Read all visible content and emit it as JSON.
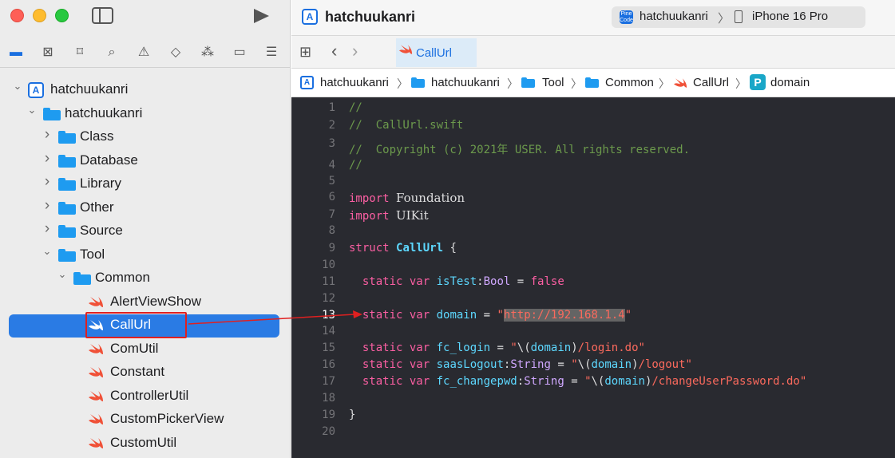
{
  "window": {
    "title": "hatchuukanri"
  },
  "scheme": {
    "name": "hatchuukanri",
    "device": "iPhone 16 Pro",
    "icon_text": "Pine Code"
  },
  "tabs": [
    {
      "label": "CallUrl"
    }
  ],
  "jumpbar": [
    {
      "label": "hatchuukanri",
      "icon": "app-project-icon"
    },
    {
      "label": "hatchuukanri",
      "icon": "folder-icon"
    },
    {
      "label": "Tool",
      "icon": "folder-icon"
    },
    {
      "label": "Common",
      "icon": "folder-icon"
    },
    {
      "label": "CallUrl",
      "icon": "swift-file-icon"
    },
    {
      "label": "domain",
      "icon": "property-icon",
      "icon_text": "P"
    }
  ],
  "navigator": {
    "tree": [
      {
        "label": "hatchuukanri",
        "icon": "app-project-icon",
        "expanded": true
      },
      {
        "label": "hatchuukanri",
        "icon": "folder-icon",
        "expanded": true
      },
      {
        "label": "Class",
        "icon": "folder-icon",
        "expanded": false
      },
      {
        "label": "Database",
        "icon": "folder-icon",
        "expanded": false
      },
      {
        "label": "Library",
        "icon": "folder-icon",
        "expanded": false
      },
      {
        "label": "Other",
        "icon": "folder-icon",
        "expanded": false
      },
      {
        "label": "Source",
        "icon": "folder-icon",
        "expanded": false
      },
      {
        "label": "Tool",
        "icon": "folder-icon",
        "expanded": true
      },
      {
        "label": "Common",
        "icon": "folder-icon",
        "expanded": true
      },
      {
        "label": "AlertViewShow",
        "icon": "swift-file-icon"
      },
      {
        "label": "CallUrl",
        "icon": "swift-file-icon",
        "selected": true
      },
      {
        "label": "ComUtil",
        "icon": "swift-file-icon"
      },
      {
        "label": "Constant",
        "icon": "swift-file-icon"
      },
      {
        "label": "ControllerUtil",
        "icon": "swift-file-icon"
      },
      {
        "label": "CustomPickerView",
        "icon": "swift-file-icon"
      },
      {
        "label": "CustomUtil",
        "icon": "swift-file-icon"
      }
    ]
  },
  "editor": {
    "current_line": 13,
    "line_numbers": [
      "1",
      "2",
      "3",
      "4",
      "5",
      "6",
      "7",
      "8",
      "9",
      "10",
      "11",
      "12",
      "13",
      "14",
      "15",
      "16",
      "17",
      "18",
      "19",
      "20"
    ],
    "lines": {
      "l1": "//",
      "l2": "//  CallUrl.swift",
      "l3": "//  Copyright (c) 2021年 USER. All rights reserved.",
      "l4": "//",
      "l6_kw": "import",
      "l6_mod": "Foundation",
      "l7_kw": "import",
      "l7_mod": "UIKit",
      "l9_kw": "struct",
      "l9_name": "CallUrl",
      "l9_brace": "{",
      "l11_kw": "static var",
      "l11_id": "isTest",
      "l11_type": "Bool",
      "l11_val": "false",
      "l13_kw": "static var",
      "l13_id": "domain",
      "l13_str": "http://192.168.1.4",
      "l15_kw": "static var",
      "l15_id": "fc_login",
      "l15_interp": "domain",
      "l15_path": "/login.do",
      "l16_kw": "static var",
      "l16_id": "saasLogout",
      "l16_type": "String",
      "l16_interp": "domain",
      "l16_path": "/logout",
      "l17_kw": "static var",
      "l17_id": "fc_changepwd",
      "l17_type": "String",
      "l17_interp": "domain",
      "l17_path": "/changeUserPassword.do",
      "l19": "}"
    }
  },
  "colors": {
    "selection": "#2a7be4",
    "annotation": "#e02020",
    "editor_bg": "#292a30",
    "keyword": "#fc5fa3",
    "string": "#fc6a5d",
    "comment": "#6c9a4c",
    "identifier": "#5dd8ff"
  }
}
